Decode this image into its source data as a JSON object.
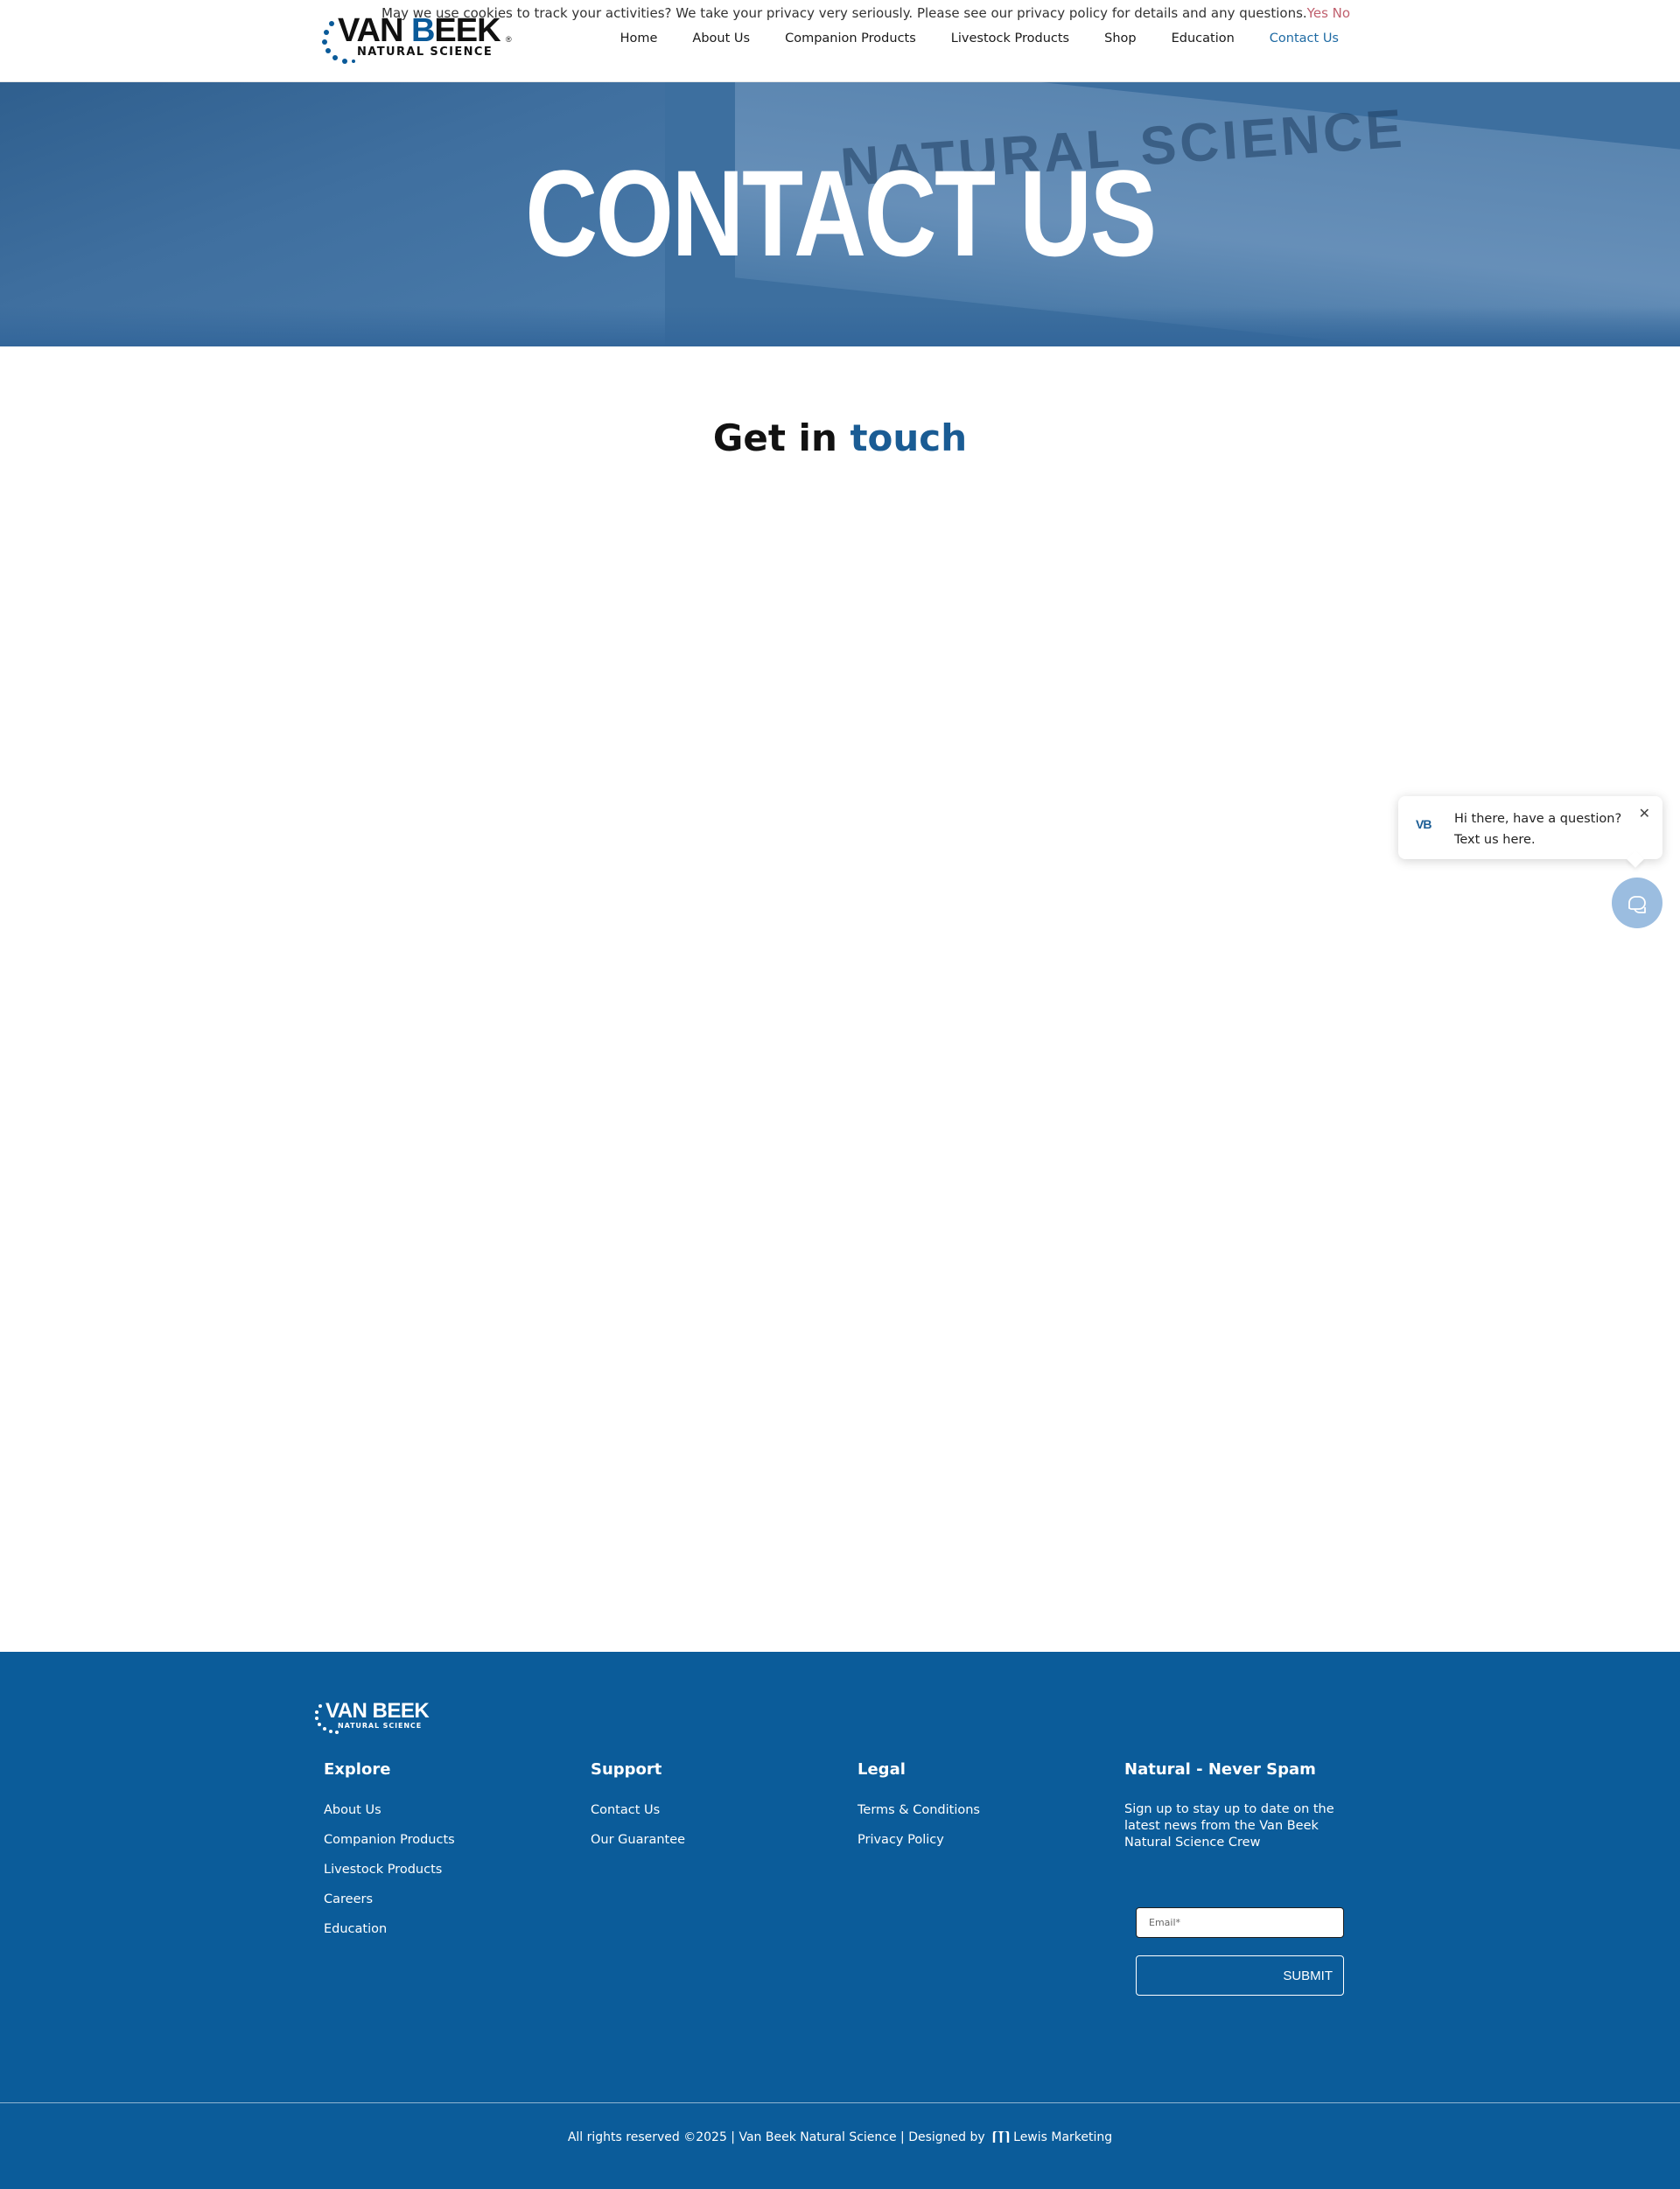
{
  "cookie_banner": {
    "text": "May we use cookies to track your activities? We take your privacy very seriously. Please see our privacy policy for details and any questions.",
    "yes_label": "Yes",
    "no_label": "No"
  },
  "header": {
    "logo": {
      "brand_a": "VAN ",
      "brand_b": "B",
      "brand_c": "EEK",
      "subtitle": "NATURAL SCIENCE",
      "registered": "®"
    },
    "nav": [
      {
        "label": "Home",
        "active": false
      },
      {
        "label": "About Us",
        "active": false
      },
      {
        "label": "Companion Products",
        "active": false
      },
      {
        "label": "Livestock Products",
        "active": false
      },
      {
        "label": "Shop",
        "active": false
      },
      {
        "label": "Education",
        "active": false
      },
      {
        "label": "Contact Us",
        "active": true
      }
    ]
  },
  "hero": {
    "title": "CONTACT US",
    "background_sign": "NATURAL SCIENCE"
  },
  "main": {
    "heading_plain": "Get in ",
    "heading_accent": "touch"
  },
  "chat_widget": {
    "avatar_text": "VB",
    "message": "Hi there, have a question? Text us here.",
    "close_icon": "close-icon",
    "fab_icon": "chat-icon"
  },
  "footer": {
    "logo": {
      "brand": "VAN BEEK",
      "subtitle": "NATURAL SCIENCE"
    },
    "explore": {
      "title": "Explore",
      "links": [
        "About Us",
        "Companion Products",
        "Livestock Products",
        "Careers",
        "Education"
      ]
    },
    "support": {
      "title": "Support",
      "links": [
        "Contact Us",
        "Our Guarantee"
      ]
    },
    "legal": {
      "title": "Legal",
      "links": [
        "Terms & Conditions",
        "Privacy Policy"
      ]
    },
    "newsletter": {
      "title": "Natural - Never Spam",
      "description": "Sign up to stay up to date on the latest news from the Van Beek Natural Science Crew",
      "email_placeholder": "Email*",
      "email_value": "",
      "submit_label": "SUBMIT"
    },
    "copyright_a": "All rights reserved ©2025 | Van Beek Natural Science | Designed by",
    "copyright_b": "Lewis Marketing"
  },
  "colors": {
    "brand_blue": "#0b5c9a",
    "accent_text": "#1a5c94",
    "nav_active": "#1e6aa3",
    "cookie_link": "#c0606e",
    "chat_fab": "#9bbde0"
  }
}
